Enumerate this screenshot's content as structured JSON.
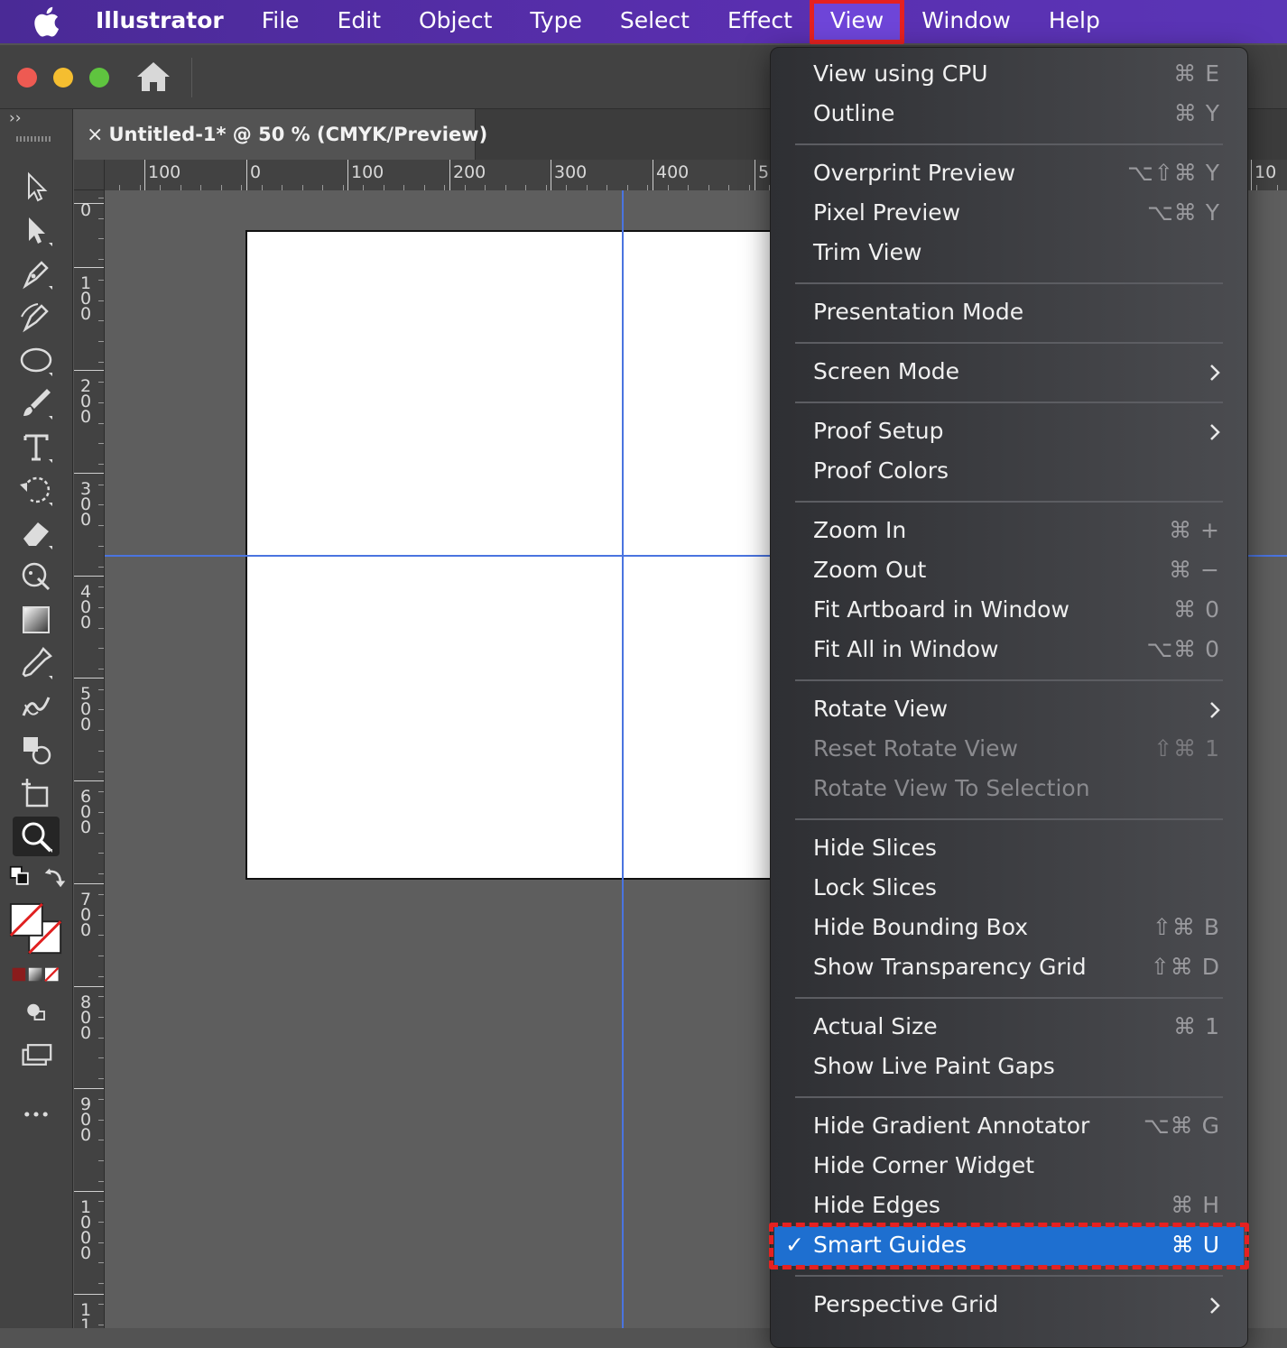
{
  "menubar": {
    "app_name": "Illustrator",
    "items": [
      "File",
      "Edit",
      "Object",
      "Type",
      "Select",
      "Effect",
      "View",
      "Window",
      "Help"
    ]
  },
  "document": {
    "tab_title": "Untitled-1* @ 50 % (CMYK/Preview)",
    "close_glyph": "×"
  },
  "ruler": {
    "top_labels": [
      "100",
      "0",
      "100",
      "200",
      "300",
      "400",
      "5",
      "10"
    ],
    "left_labels": [
      "0",
      "100",
      "200",
      "300",
      "400",
      "500",
      "600",
      "700",
      "800",
      "900",
      "1000",
      "110"
    ]
  },
  "view_menu": {
    "items": [
      {
        "label": "View using CPU",
        "shortcut": "⌘ E"
      },
      {
        "label": "Outline",
        "shortcut": "⌘ Y"
      },
      {
        "label": "Overprint Preview",
        "shortcut": "⌥⇧⌘ Y"
      },
      {
        "label": "Pixel Preview",
        "shortcut": "⌥⌘ Y"
      },
      {
        "label": "Trim View",
        "shortcut": ""
      },
      {
        "label": "Presentation Mode",
        "shortcut": ""
      },
      {
        "label": "Screen Mode",
        "shortcut": ""
      },
      {
        "label": "Proof Setup",
        "shortcut": ""
      },
      {
        "label": "Proof Colors",
        "shortcut": ""
      },
      {
        "label": "Zoom In",
        "shortcut": "⌘ +"
      },
      {
        "label": "Zoom Out",
        "shortcut": "⌘ −"
      },
      {
        "label": "Fit Artboard in Window",
        "shortcut": "⌘ 0"
      },
      {
        "label": "Fit All in Window",
        "shortcut": "⌥⌘ 0"
      },
      {
        "label": "Rotate View",
        "shortcut": ""
      },
      {
        "label": "Reset Rotate View",
        "shortcut": "⇧⌘ 1"
      },
      {
        "label": "Rotate View To Selection",
        "shortcut": ""
      },
      {
        "label": "Hide Slices",
        "shortcut": ""
      },
      {
        "label": "Lock Slices",
        "shortcut": ""
      },
      {
        "label": "Hide Bounding Box",
        "shortcut": "⇧⌘ B"
      },
      {
        "label": "Show Transparency Grid",
        "shortcut": "⇧⌘ D"
      },
      {
        "label": "Actual Size",
        "shortcut": "⌘ 1"
      },
      {
        "label": "Show Live Paint Gaps",
        "shortcut": ""
      },
      {
        "label": "Hide Gradient Annotator",
        "shortcut": "⌥⌘ G"
      },
      {
        "label": "Hide Corner Widget",
        "shortcut": ""
      },
      {
        "label": "Hide Edges",
        "shortcut": "⌘ H"
      },
      {
        "label": "Smart Guides",
        "shortcut": "⌘ U",
        "check": "✓"
      },
      {
        "label": "Perspective Grid",
        "shortcut": ""
      }
    ]
  },
  "colors": {
    "menubar": "#5a2fb0",
    "highlight": "#1e6fd0",
    "annotation": "#e52121",
    "guide": "#4a74e0"
  }
}
